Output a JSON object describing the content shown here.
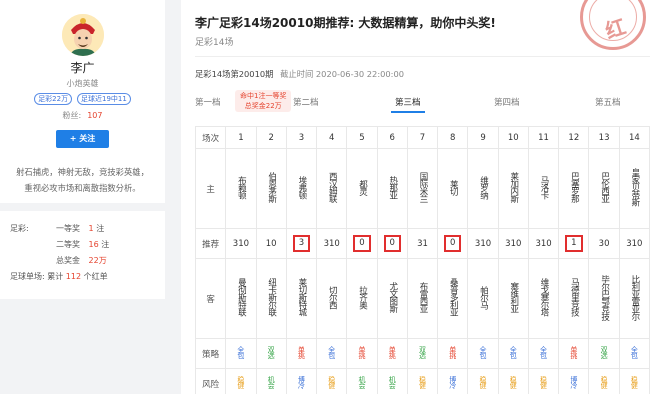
{
  "profile": {
    "name": "李广",
    "subtitle": "小炮英雄",
    "tags": [
      "足彩22万",
      "足球近19中11"
    ],
    "fans_label": "粉丝:",
    "fans_count": "107",
    "follow_label": "+ 关注",
    "bio": "射石捕虎，神射无敌，竞技彩英雄，重视必攻市场和离散指数分析。"
  },
  "record": {
    "label_zucai": "足彩:",
    "first_prize_label": "一等奖",
    "first_prize_count": "1",
    "second_prize_label": "二等奖",
    "second_prize_count": "16",
    "unit_zhu": "注",
    "total_label": "总奖金",
    "total_amount": "22万",
    "single_label": "足球单场:",
    "single_prefix": "累计",
    "single_count": "112",
    "single_suffix": "个红单"
  },
  "article": {
    "title": "李广足彩14场20010期推荐: 大数据精算，助你中头奖!",
    "breadcrumb": "足彩14场",
    "stamp_char": "红",
    "period_label": "足彩14场第20010期",
    "deadline": "截止时间 2020-06-30 22:00:00"
  },
  "tabs": [
    {
      "label": "第一档"
    },
    {
      "label": "第二档"
    },
    {
      "label": "第三档"
    },
    {
      "label": "第四档"
    },
    {
      "label": "第五档"
    }
  ],
  "badge": {
    "line1": "命中1注一等奖",
    "line2": "总奖金22万"
  },
  "table": {
    "headers": {
      "match": "场次",
      "home": "主",
      "pick": "推荐",
      "away": "客",
      "strategy": "策略",
      "risk": "风险"
    },
    "matches": [
      {
        "no": "1",
        "home": "布赖顿",
        "pick": "310",
        "boxed": false,
        "away": "曼彻斯特联",
        "strategy": "全包",
        "strategy_color": "blue",
        "risk": "稳健",
        "risk_color": "orange"
      },
      {
        "no": "2",
        "home": "伯恩茅斯",
        "pick": "10",
        "boxed": false,
        "away": "纽卡斯尔联",
        "strategy": "双选",
        "strategy_color": "green",
        "risk": "机会",
        "risk_color": "green"
      },
      {
        "no": "3",
        "home": "埃弗顿",
        "pick": "3",
        "boxed": true,
        "away": "莱切斯特城",
        "strategy": "单挑",
        "strategy_color": "red",
        "risk": "博冷",
        "risk_color": "blue"
      },
      {
        "no": "4",
        "home": "西汉姆联",
        "pick": "310",
        "boxed": false,
        "away": "切尔西",
        "strategy": "全包",
        "strategy_color": "blue",
        "risk": "稳健",
        "risk_color": "orange"
      },
      {
        "no": "5",
        "home": "都灵",
        "pick": "0",
        "boxed": true,
        "away": "拉齐奥",
        "strategy": "单挑",
        "strategy_color": "red",
        "risk": "机会",
        "risk_color": "green"
      },
      {
        "no": "6",
        "home": "热那亚",
        "pick": "0",
        "boxed": true,
        "away": "尤文图斯",
        "strategy": "单挑",
        "strategy_color": "red",
        "risk": "机会",
        "risk_color": "green"
      },
      {
        "no": "7",
        "home": "国际米兰",
        "pick": "31",
        "boxed": false,
        "away": "布雷西亚",
        "strategy": "双选",
        "strategy_color": "green",
        "risk": "稳健",
        "risk_color": "orange"
      },
      {
        "no": "8",
        "home": "莱切",
        "pick": "0",
        "boxed": true,
        "away": "桑普多利亚",
        "strategy": "单挑",
        "strategy_color": "red",
        "risk": "博冷",
        "risk_color": "blue"
      },
      {
        "no": "9",
        "home": "维罗纳",
        "pick": "310",
        "boxed": false,
        "away": "帕尔马",
        "strategy": "全包",
        "strategy_color": "blue",
        "risk": "稳健",
        "risk_color": "orange"
      },
      {
        "no": "10",
        "home": "莱加内斯",
        "pick": "310",
        "boxed": false,
        "away": "塞维利亚",
        "strategy": "全包",
        "strategy_color": "blue",
        "risk": "稳健",
        "risk_color": "orange"
      },
      {
        "no": "11",
        "home": "马洛卡",
        "pick": "310",
        "boxed": false,
        "away": "维戈塞尔塔",
        "strategy": "全包",
        "strategy_color": "blue",
        "risk": "稳健",
        "risk_color": "orange"
      },
      {
        "no": "12",
        "home": "巴塞罗那",
        "pick": "1",
        "boxed": true,
        "away": "马德里竞技",
        "strategy": "单挑",
        "strategy_color": "red",
        "risk": "博冷",
        "risk_color": "blue"
      },
      {
        "no": "13",
        "home": "巴伦西亚",
        "pick": "30",
        "boxed": false,
        "away": "毕尔巴鄂竞技",
        "strategy": "双选",
        "strategy_color": "green",
        "risk": "稳健",
        "risk_color": "orange"
      },
      {
        "no": "14",
        "home": "皇家贝蒂斯",
        "pick": "310",
        "boxed": false,
        "away": "比利亚雷亚尔",
        "strategy": "全包",
        "strategy_color": "blue",
        "risk": "稳健",
        "risk_color": "orange"
      }
    ]
  },
  "colors": {
    "accent": "#1f7fe6",
    "red": "#e5442f",
    "box": "#e12e2e"
  },
  "icons": {
    "avatar": "avatar-illustration",
    "stamp": "red-stamp"
  }
}
